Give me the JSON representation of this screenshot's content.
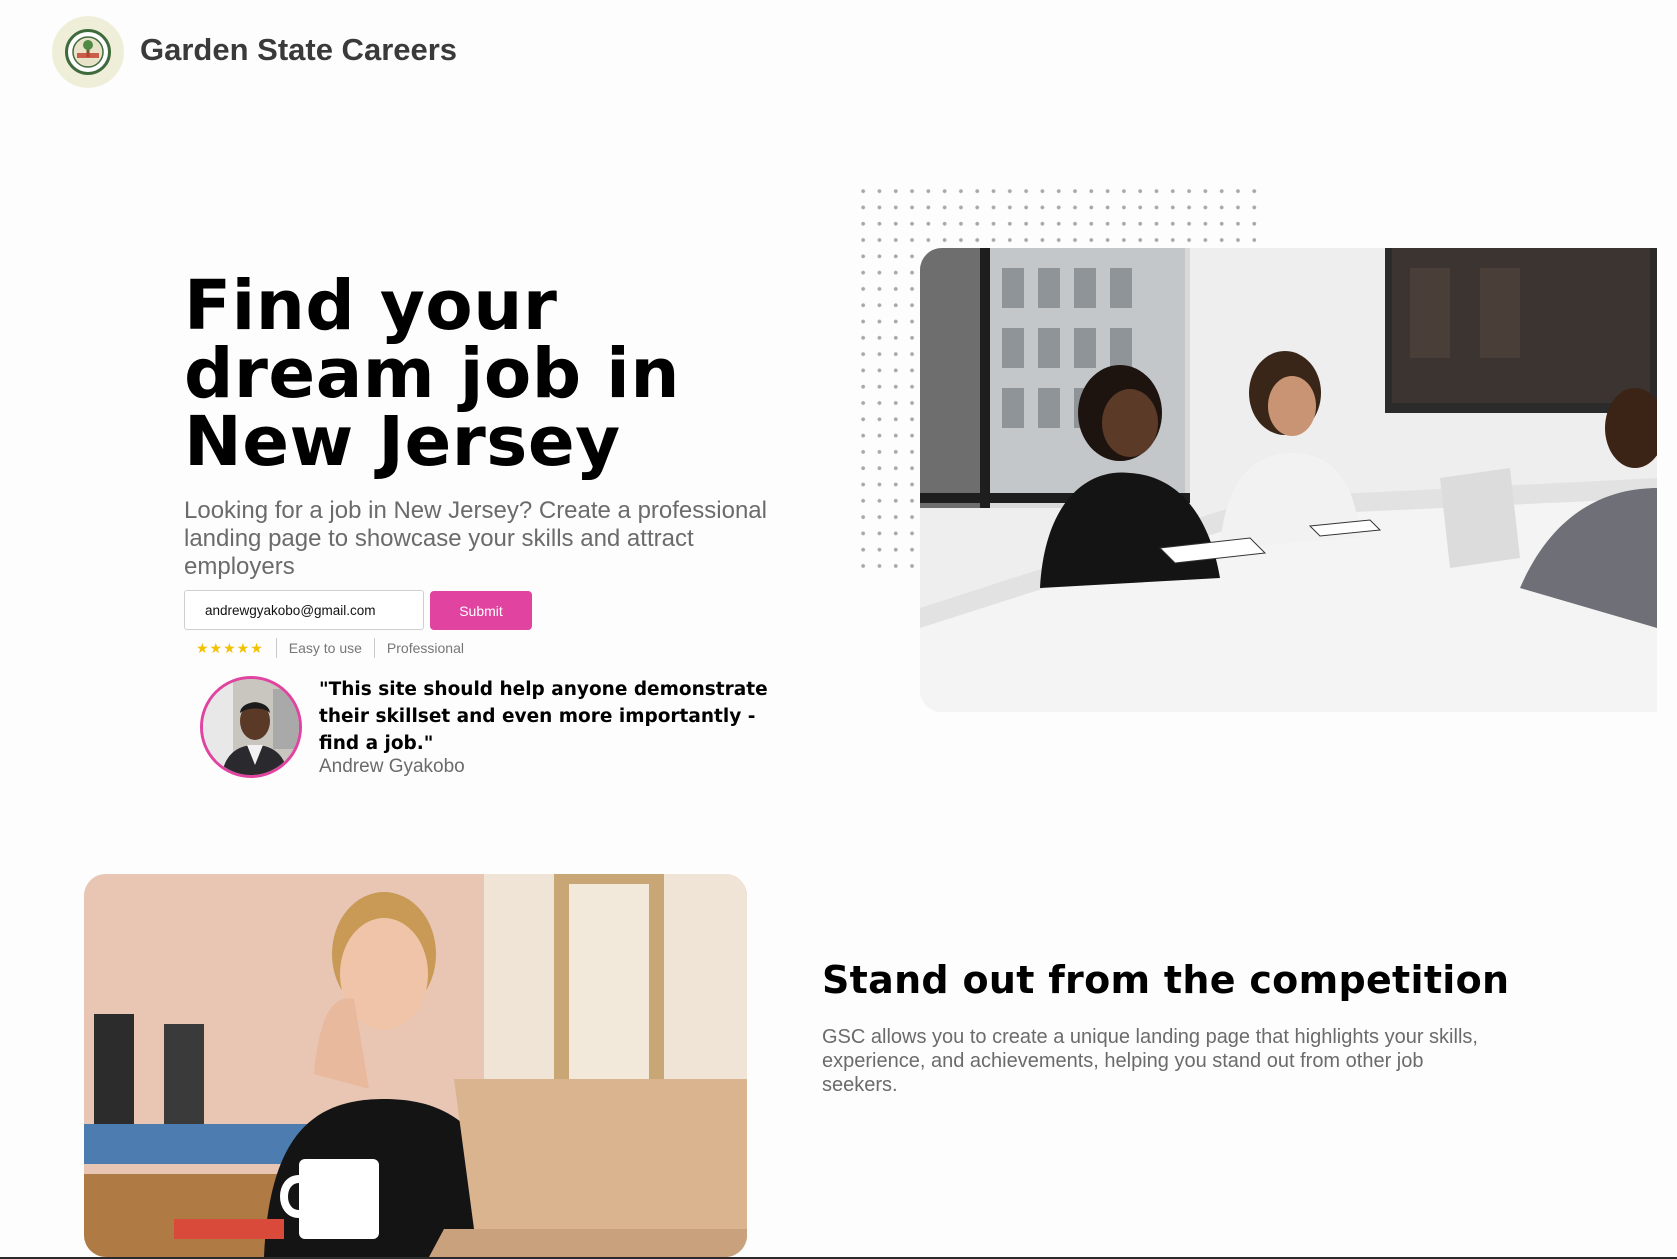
{
  "header": {
    "brand": "Garden State Careers",
    "logo_icon": "garden-state-seal-logo"
  },
  "hero": {
    "title": "Find your dream job in New Jersey",
    "subtitle": "Looking for a job in New Jersey? Create a professional landing page to showcase your skills and attract employers",
    "email_value": "andrewgyakobo@gmail.com",
    "submit_label": "Submit",
    "rating_stars": "★★★★★",
    "rating_value": 5,
    "tags": [
      "Easy to use",
      "Professional"
    ],
    "testimonial": {
      "quote": "\"This site should help anyone demonstrate their skillset and even more importantly - find a job.\"",
      "author": "Andrew Gyakobo"
    },
    "photo_icon": "office-meeting-photo"
  },
  "feature": {
    "title": "Stand out from the competition",
    "text": "GSC allows you to create a unique landing page that highlights your skills, experience, and achievements, helping you stand out from other job seekers.",
    "photo_icon": "woman-at-laptop-photo"
  },
  "colors": {
    "accent": "#e043a0",
    "star": "#f2c100",
    "muted_text": "#6b6b6b",
    "logo_bg": "#efefd9"
  }
}
